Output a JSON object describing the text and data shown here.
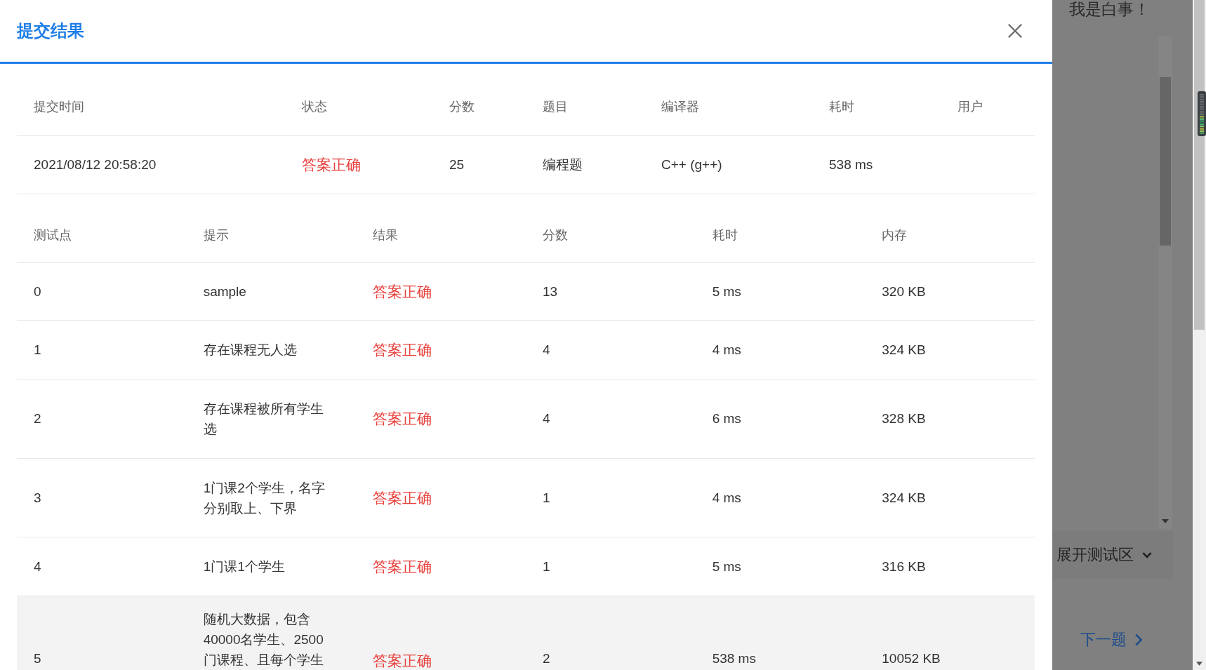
{
  "dialog": {
    "title": "提交结果"
  },
  "submission": {
    "columns": [
      "提交时间",
      "状态",
      "分数",
      "题目",
      "编译器",
      "耗时",
      "用户"
    ],
    "row": {
      "submitted": "2021/08/12 20:58:20",
      "status": "答案正确",
      "score": "25",
      "problem": "编程题",
      "compiler": "C++ (g++)",
      "time": "538 ms"
    }
  },
  "tests": {
    "columns": [
      "测试点",
      "提示",
      "结果",
      "分数",
      "耗时",
      "内存"
    ],
    "rows": [
      {
        "id": "0",
        "hint": "sample",
        "result": "答案正确",
        "score": "13",
        "time": "5 ms",
        "memory": "320 KB",
        "highlighted": false
      },
      {
        "id": "1",
        "hint": "存在课程无人选",
        "result": "答案正确",
        "score": "4",
        "time": "4 ms",
        "memory": "324 KB",
        "highlighted": false
      },
      {
        "id": "2",
        "hint": "存在课程被所有学生选",
        "result": "答案正确",
        "score": "4",
        "time": "6 ms",
        "memory": "328 KB",
        "highlighted": false
      },
      {
        "id": "3",
        "hint": "1门课2个学生，名字分别取上、下界",
        "result": "答案正确",
        "score": "1",
        "time": "4 ms",
        "memory": "324 KB",
        "highlighted": false
      },
      {
        "id": "4",
        "hint": "1门课1个学生",
        "result": "答案正确",
        "score": "1",
        "time": "5 ms",
        "memory": "316 KB",
        "highlighted": false
      },
      {
        "id": "5",
        "hint": "随机大数据，包含40000名学生、2500门课程、且每个学生",
        "result": "答案正确",
        "score": "2",
        "time": "538 ms",
        "memory": "10052 KB",
        "highlighted": true
      }
    ]
  },
  "background": {
    "heading": "我是白事！",
    "expand_button": "展开测试区",
    "next_link": "下一题"
  }
}
